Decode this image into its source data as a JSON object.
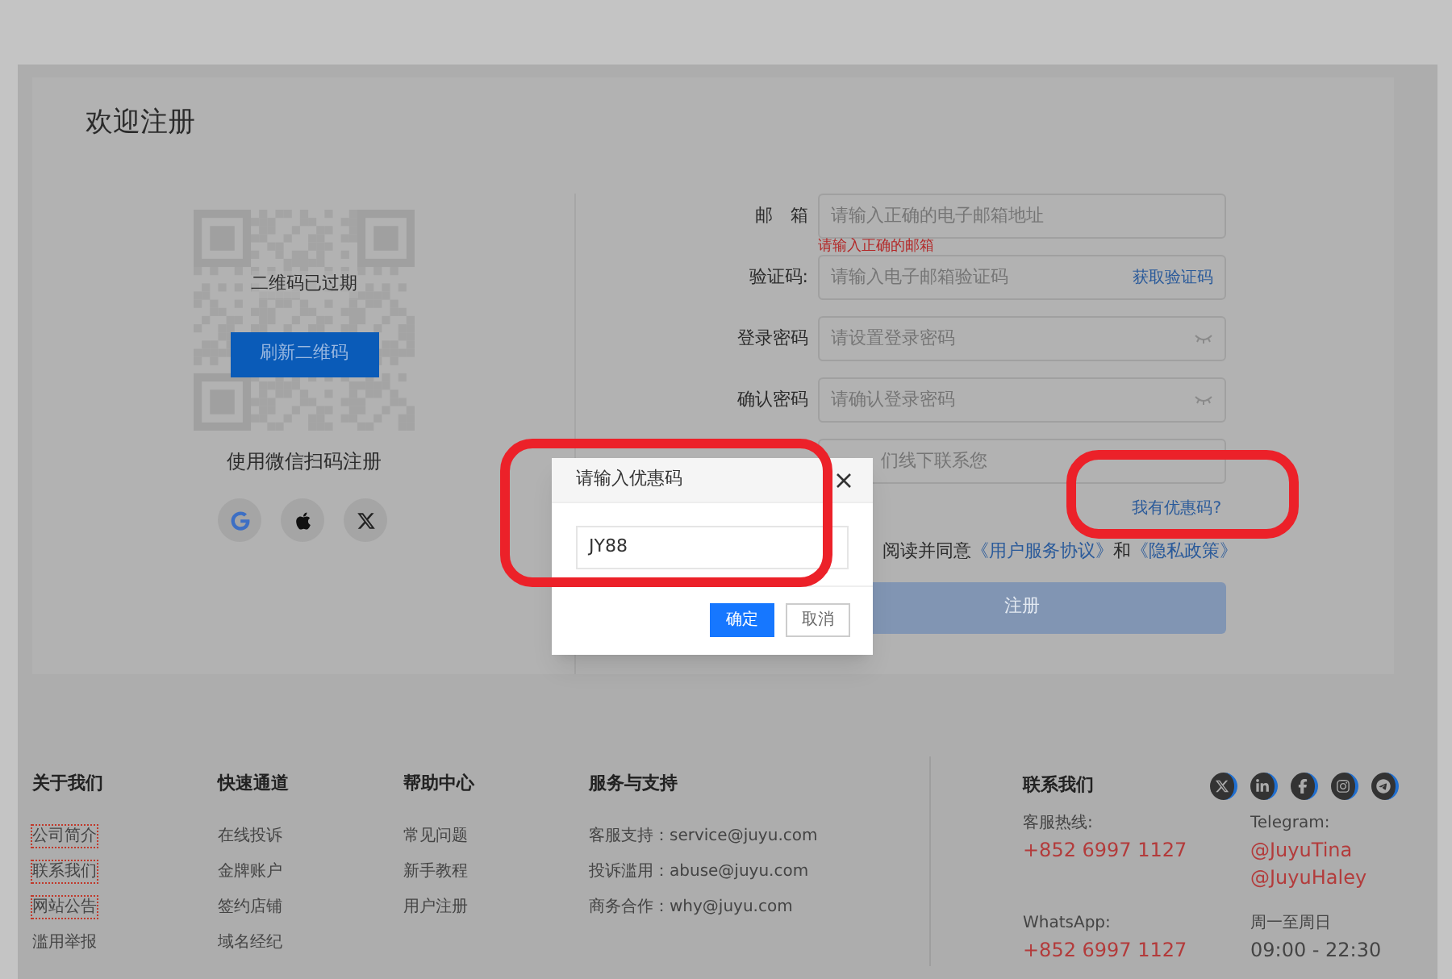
{
  "register": {
    "title": "欢迎注册",
    "qr": {
      "expired_text": "二维码已过期",
      "refresh_button": "刷新二维码",
      "caption": "使用微信扫码注册"
    },
    "social_logins": [
      {
        "kind": "google"
      },
      {
        "kind": "apple"
      },
      {
        "kind": "x"
      }
    ],
    "form": {
      "fields": [
        {
          "kind": "text",
          "label": "邮　箱",
          "placeholder": "请输入正确的电子邮箱地址",
          "error": "请输入正确的邮箱"
        },
        {
          "kind": "code",
          "label": "验证码:",
          "placeholder": "请输入电子邮箱验证码",
          "action": "获取验证码"
        },
        {
          "kind": "password",
          "label": "登录密码",
          "placeholder": "请设置登录密码"
        },
        {
          "kind": "password",
          "label": "确认密码",
          "placeholder": "请确认登录密码"
        },
        {
          "kind": "text",
          "placeholder": "们线下联系您"
        }
      ],
      "coupon_link": "我有优惠码?",
      "agreement": {
        "text": "阅读并同意",
        "link_1": "《用户服务协议》",
        "joiner": "和",
        "link_2": "《隐私政策》"
      },
      "submit_button": {
        "label": "注册",
        "disabled": true
      }
    }
  },
  "dialog": {
    "title": "请输入优惠码",
    "value": "JY88",
    "ok_button": "确定",
    "cancel_button": "取消"
  },
  "footer": {
    "columns": [
      {
        "heading": "关于我们",
        "items": [
          {
            "label": "公司简介",
            "focused": true
          },
          {
            "label": "联系我们",
            "focused": true
          },
          {
            "label": "网站公告",
            "focused": true
          },
          {
            "label": "滥用举报",
            "focused": false
          }
        ]
      },
      {
        "heading": "快速通道",
        "items": [
          {
            "label": "在线投诉",
            "focused": false
          },
          {
            "label": "金牌账户",
            "focused": false
          },
          {
            "label": "签约店铺",
            "focused": false
          },
          {
            "label": "域名经纪",
            "focused": false
          }
        ]
      },
      {
        "heading": "帮助中心",
        "items": [
          {
            "label": "常见问题",
            "focused": false
          },
          {
            "label": "新手教程",
            "focused": false
          },
          {
            "label": "用户注册",
            "focused": false
          }
        ]
      },
      {
        "heading": "服务与支持",
        "items": [
          {
            "label": "客服支持：service@juyu.com",
            "focused": false
          },
          {
            "label": "投诉滥用：abuse@juyu.com",
            "focused": false
          },
          {
            "label": "商务合作：why@juyu.com",
            "focused": false
          }
        ]
      }
    ],
    "contact": {
      "heading": "联系我们",
      "socials": [
        {
          "kind": "x"
        },
        {
          "kind": "linkedin"
        },
        {
          "kind": "facebook"
        },
        {
          "kind": "instagram"
        },
        {
          "kind": "telegram"
        }
      ],
      "blocks": [
        {
          "label": "客服热线:",
          "values": [
            "+852 6997 1127"
          ],
          "highlight": true
        },
        {
          "label": "Telegram:",
          "values": [
            "@JuyuTina",
            "@JuyuHaley"
          ],
          "highlight": true
        },
        {
          "label": "WhatsApp:",
          "values": [
            "+852 6997 1127"
          ],
          "highlight": true
        },
        {
          "label": "周一至周日",
          "values": [
            "09:00 - 22:30"
          ],
          "highlight": false
        }
      ]
    }
  }
}
